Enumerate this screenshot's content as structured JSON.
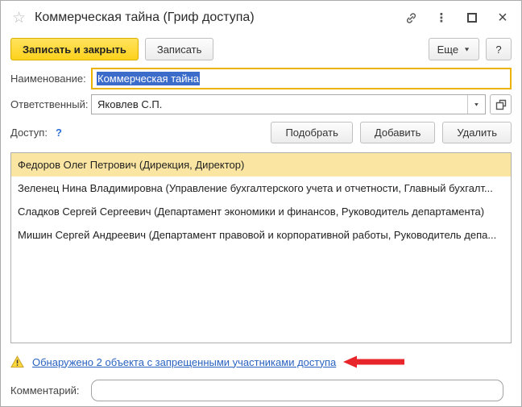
{
  "window": {
    "title": "Коммерческая тайна (Гриф доступа)"
  },
  "icons": {
    "star": "☆",
    "kebab": "⋮",
    "close": "×",
    "dropdown_arrow": "▼",
    "more_arrow": "▼"
  },
  "toolbar": {
    "save_and_close": "Записать и закрыть",
    "save": "Записать",
    "more": "Еще",
    "help": "?"
  },
  "form": {
    "name": {
      "label": "Наименование:",
      "value": "Коммерческая тайна"
    },
    "responsible": {
      "label": "Ответственный:",
      "value": "Яковлев С.П."
    }
  },
  "access": {
    "label": "Доступ:",
    "help": "?",
    "buttons": [
      "Подобрать",
      "Добавить",
      "Удалить"
    ],
    "rows": [
      {
        "text": "Федоров Олег Петрович (Дирекция, Директор)",
        "selected": true
      },
      {
        "text": "Зеленец Нина Владимировна (Управление бухгалтерского учета и отчетности, Главный бухгалт...",
        "selected": false
      },
      {
        "text": "Сладков Сергей Сергеевич (Департамент экономики и финансов, Руководитель департамента)",
        "selected": false
      },
      {
        "text": "Мишин Сергей Андреевич (Департамент правовой и корпоративной работы, Руководитель депа...",
        "selected": false
      }
    ]
  },
  "warning": {
    "link_text": "Обнаружено 2 объекта с запрещенными участниками доступа"
  },
  "comment": {
    "label": "Комментарий:",
    "value": ""
  },
  "colors": {
    "accent_yellow_button": "#FDD21C",
    "focused_field_border": "#ECB200",
    "selected_row": "#FBE5A2",
    "text_selection_blue": "#3B6CC9",
    "link_blue": "#2A63C0",
    "arrow_red": "#E8252A",
    "warning_triangle": "#FFD83D"
  }
}
